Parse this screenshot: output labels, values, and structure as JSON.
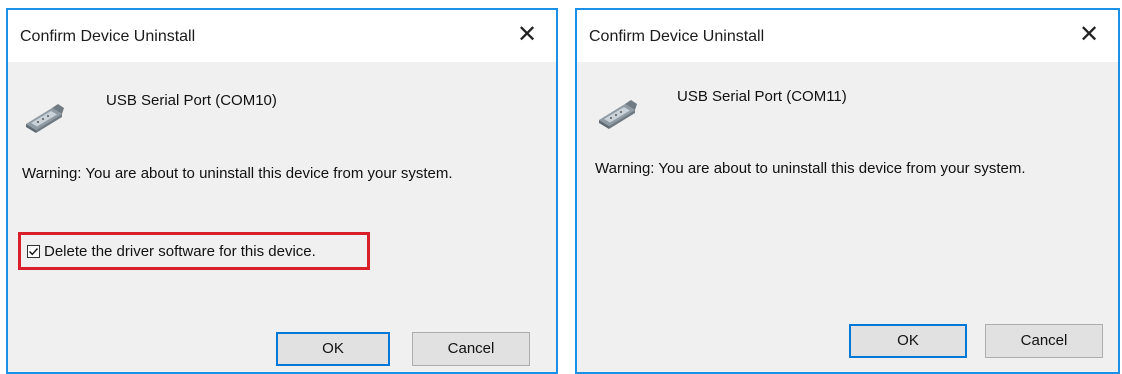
{
  "dialogs": [
    {
      "title": "Confirm Device Uninstall",
      "close_label": "✕",
      "device_icon": "serial-port-connector-icon",
      "device_name": "USB Serial Port (COM10)",
      "warning": "Warning: You are about to uninstall this device from your system.",
      "checkbox": {
        "label": "Delete the driver software for this device.",
        "checked": true,
        "highlight_color": "#d9202a"
      },
      "ok_label": "OK",
      "cancel_label": "Cancel"
    },
    {
      "title": "Confirm Device Uninstall",
      "close_label": "✕",
      "device_icon": "serial-port-connector-icon",
      "device_name": "USB Serial Port (COM11)",
      "warning": "Warning: You are about to uninstall this device from your system.",
      "ok_label": "OK",
      "cancel_label": "Cancel"
    }
  ],
  "colors": {
    "window_border": "#1a91e6",
    "dialog_background": "#f0f0f0",
    "default_button_border": "#0078d7"
  }
}
